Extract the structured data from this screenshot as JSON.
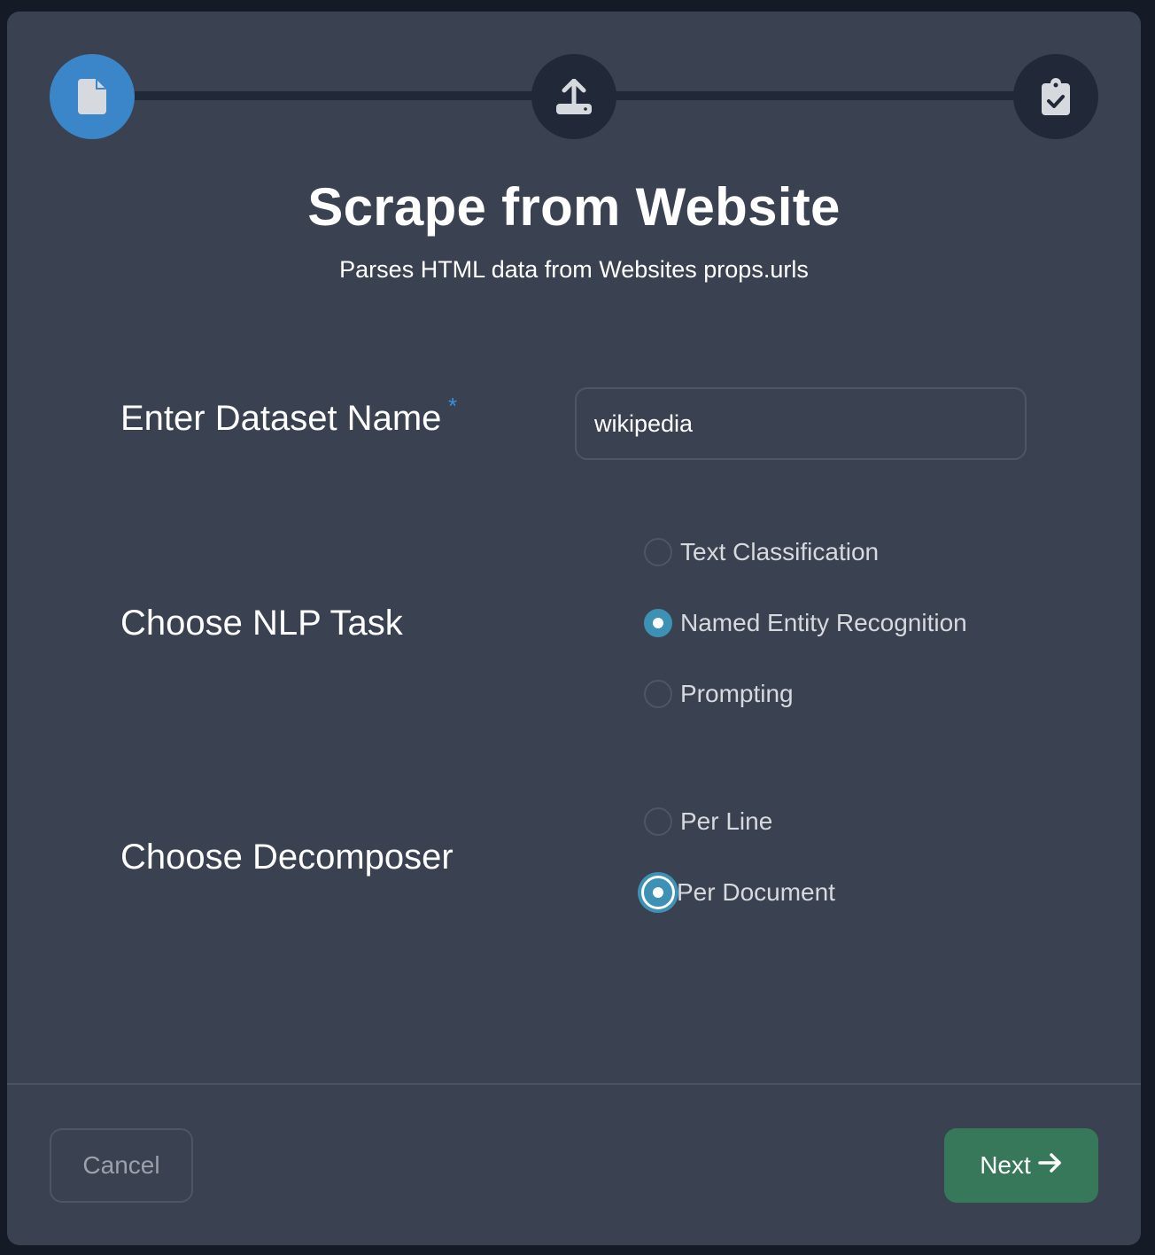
{
  "stepper": {
    "steps": [
      {
        "icon": "file-icon",
        "state": "active"
      },
      {
        "icon": "upload-icon",
        "state": "inactive"
      },
      {
        "icon": "clipboard-check-icon",
        "state": "inactive"
      }
    ]
  },
  "header": {
    "title": "Scrape from Website",
    "subtitle": "Parses HTML data from Websites props.urls"
  },
  "form": {
    "dataset_name": {
      "label": "Enter Dataset Name",
      "required_marker": "*",
      "value": "wikipedia"
    },
    "nlp_task": {
      "label": "Choose NLP Task",
      "options": [
        {
          "label": "Text Classification",
          "checked": false
        },
        {
          "label": "Named Entity Recognition",
          "checked": true
        },
        {
          "label": "Prompting",
          "checked": false
        }
      ]
    },
    "decomposer": {
      "label": "Choose Decomposer",
      "options": [
        {
          "label": "Per Line",
          "checked": false
        },
        {
          "label": "Per Document",
          "checked": true,
          "focused": true
        }
      ]
    }
  },
  "footer": {
    "cancel_label": "Cancel",
    "next_label": "Next"
  },
  "colors": {
    "accent_blue": "#3a86c8",
    "radio_checked": "#3d91b5",
    "next_button": "#37785a",
    "modal_bg": "#3a4150",
    "page_bg": "#151a27"
  }
}
